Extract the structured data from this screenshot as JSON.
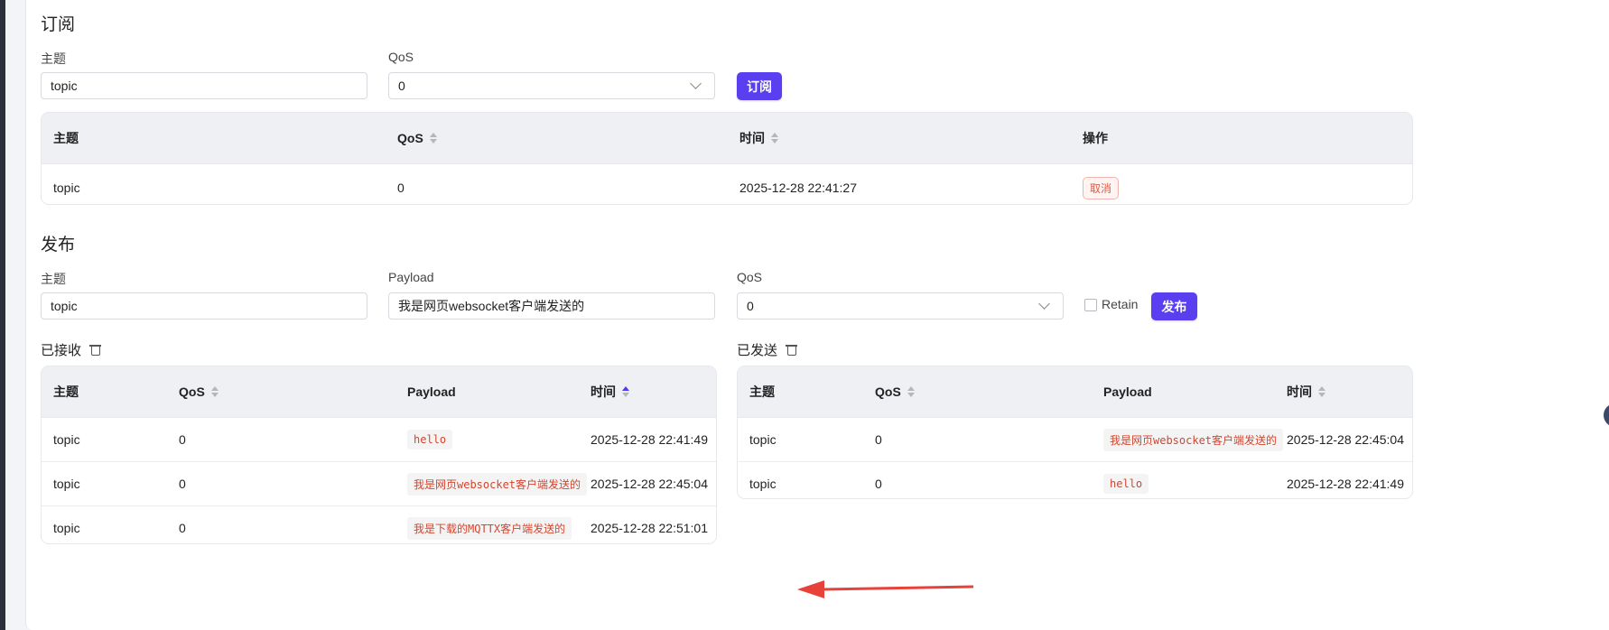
{
  "subscribe": {
    "title": "订阅",
    "topic_label": "主题",
    "topic_value": "topic",
    "qos_label": "QoS",
    "qos_value": "0",
    "button": "订阅",
    "table": {
      "headers": [
        "主题",
        "QoS",
        "时间",
        "操作"
      ],
      "rows": [
        {
          "topic": "topic",
          "qos": "0",
          "time": "2025-12-28 22:41:27",
          "action": "取消"
        }
      ]
    }
  },
  "publish": {
    "title": "发布",
    "topic_label": "主题",
    "topic_value": "topic",
    "payload_label": "Payload",
    "payload_value": "我是网页websocket客户端发送的",
    "qos_label": "QoS",
    "qos_value": "0",
    "retain_label": "Retain",
    "button": "发布"
  },
  "received": {
    "title": "已接收",
    "headers": [
      "主题",
      "QoS",
      "Payload",
      "时间"
    ],
    "rows": [
      {
        "topic": "topic",
        "qos": "0",
        "payload": "hello",
        "time": "2025-12-28 22:41:49"
      },
      {
        "topic": "topic",
        "qos": "0",
        "payload": "我是网页websocket客户端发送的",
        "time": "2025-12-28 22:45:04"
      },
      {
        "topic": "topic",
        "qos": "0",
        "payload": "我是下载的MQTTX客户端发送的",
        "time": "2025-12-28 22:51:01"
      }
    ]
  },
  "sent": {
    "title": "已发送",
    "headers": [
      "主题",
      "QoS",
      "Payload",
      "时间"
    ],
    "rows": [
      {
        "topic": "topic",
        "qos": "0",
        "payload": "我是网页websocket客户端发送的",
        "time": "2025-12-28 22:45:04"
      },
      {
        "topic": "topic",
        "qos": "0",
        "payload": "hello",
        "time": "2025-12-28 22:41:49"
      }
    ]
  },
  "colors": {
    "accent": "#5a3ff0",
    "annotation_arrow": "#e8413a",
    "payload_text": "#d2462e",
    "cancel_text": "#e05a45"
  },
  "icons": [
    "trash-icon",
    "chevron-down-icon",
    "sort-icon",
    "arrow-annotation"
  ]
}
